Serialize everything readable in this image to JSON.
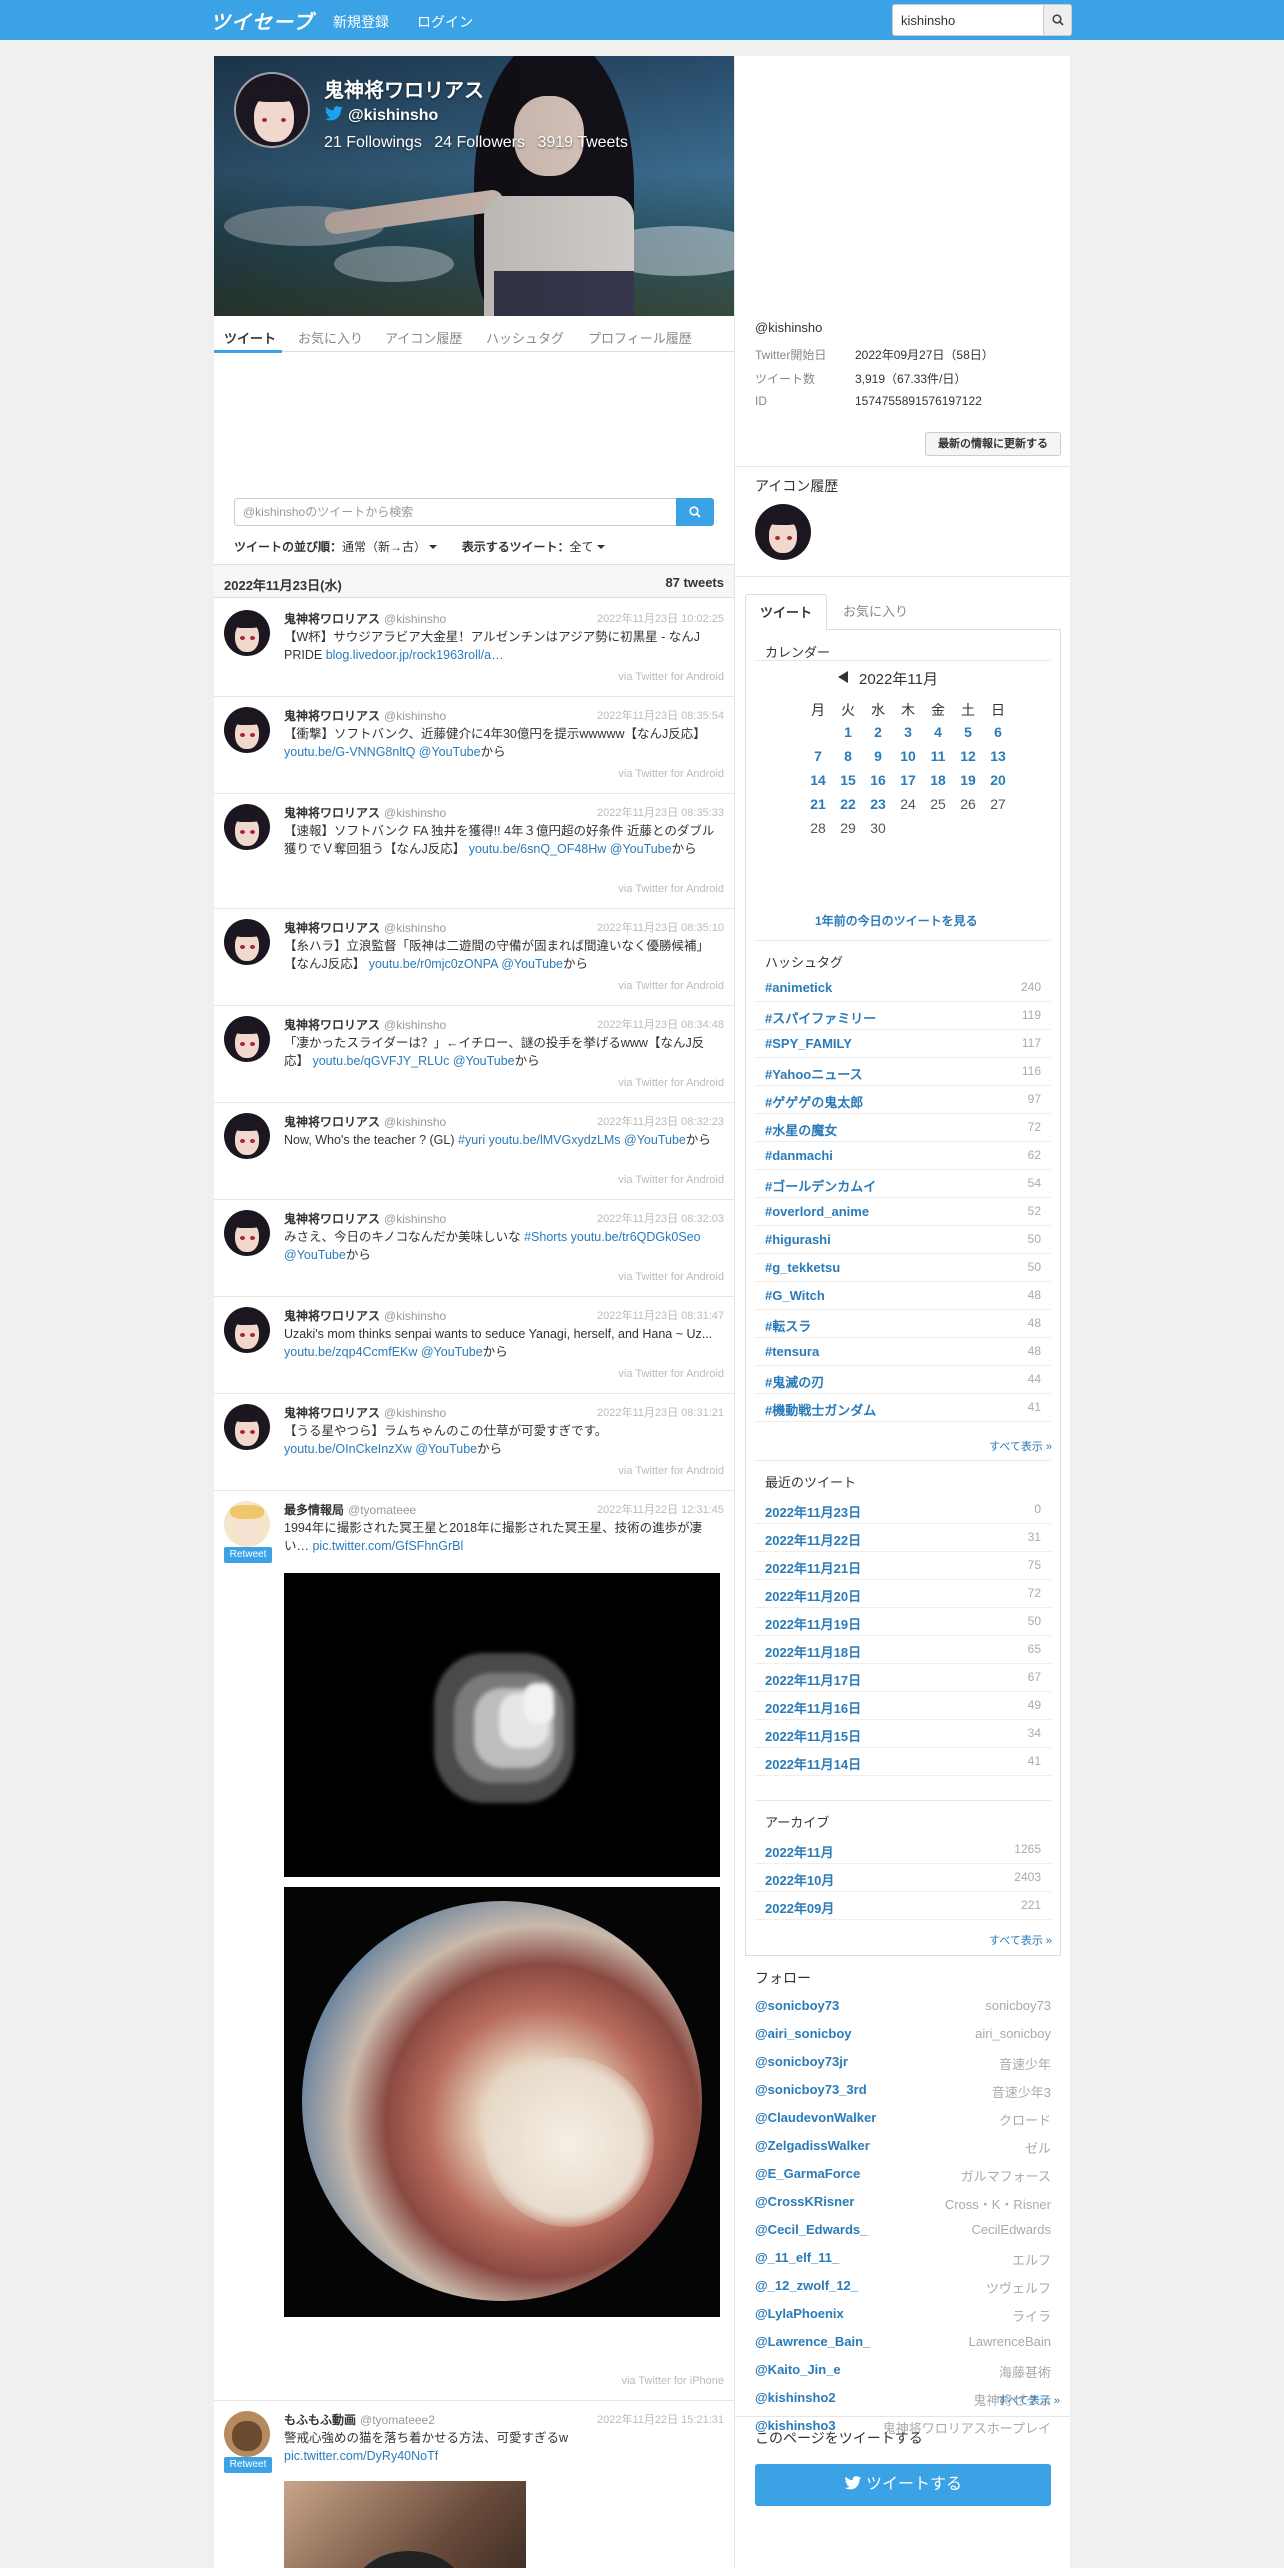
{
  "header": {
    "logo": "ツイセーブ",
    "nav": [
      "新規登録",
      "ログイン"
    ],
    "search_value": "kishinsho"
  },
  "profile": {
    "name": "鬼神将ワロリアス",
    "handle": "@kishinsho",
    "followings": "21 Followings",
    "followers": "24 Followers",
    "tweets": "3919 Tweets"
  },
  "tabs": [
    "ツイート",
    "お気に入り",
    "アイコン履歴",
    "ハッシュタグ",
    "プロフィール履歴"
  ],
  "tweet_search": {
    "placeholder": "@kishinshoのツイートから検索"
  },
  "sort": {
    "label": "ツイートの並び順：",
    "value": "通常（新→古）",
    "filter_label": "表示するツイート：",
    "filter_value": "全て"
  },
  "day_header": {
    "date": "2022年11月23日(水)",
    "count": "87 tweets"
  },
  "tweets": [
    {
      "name": "鬼神将ワロリアス",
      "handle": "@kishinsho",
      "time": "2022年11月23日 10:02:25",
      "text": "【W杯】サウジアラビア大金星！アルゼンチンはアジア勢に初黒星 - なんJ PRIDE ",
      "link": "blog.livedoor.jp/rock1963roll/a…",
      "suffix": "",
      "via": "via Twitter for Android"
    },
    {
      "name": "鬼神将ワロリアス",
      "handle": "@kishinsho",
      "time": "2022年11月23日 08:35:54",
      "text": "【衝撃】ソフトバンク、近藤健介に4年30億円を提示wwwww【なんJ反応】 ",
      "link": "youtu.be/G-VNNG8nltQ @YouTube",
      "suffix": "から",
      "via": "via Twitter for Android"
    },
    {
      "name": "鬼神将ワロリアス",
      "handle": "@kishinsho",
      "time": "2022年11月23日 08:35:33",
      "text": "【速報】ソフトバンク FA 独井を獲得!! 4年３億円超の好条件 近藤とのダブル獲りでＶ奪回狙う【なんJ反応】 ",
      "link": "youtu.be/6snQ_OF48Hw @YouTube",
      "suffix": "から",
      "via": "via Twitter for Android"
    },
    {
      "name": "鬼神将ワロリアス",
      "handle": "@kishinsho",
      "time": "2022年11月23日 08:35:10",
      "text": "【糸ハラ】立浪監督「阪神は二遊間の守備が固まれば間違いなく優勝候補」【なんJ反応】 ",
      "link": "youtu.be/r0mjc0zONPA @YouTube",
      "suffix": "から",
      "via": "via Twitter for Android"
    },
    {
      "name": "鬼神将ワロリアス",
      "handle": "@kishinsho",
      "time": "2022年11月23日 08:34:48",
      "text": "「凄かったスライダーは？」←イチロー、謎の投手を挙げるwww【なんJ反応】 ",
      "link": "youtu.be/qGVFJY_RLUc @YouTube",
      "suffix": "から",
      "via": "via Twitter for Android"
    },
    {
      "name": "鬼神将ワロリアス",
      "handle": "@kishinsho",
      "time": "2022年11月23日 08:32:23",
      "text": "Now, Who's the teacher ? (GL) ",
      "link": "#yuri youtu.be/lMVGxydzLMs @YouTube",
      "suffix": "から",
      "via": "via Twitter for Android"
    },
    {
      "name": "鬼神将ワロリアス",
      "handle": "@kishinsho",
      "time": "2022年11月23日 08:32:03",
      "text": "みさえ、今日のキノコなんだか美味しいな ",
      "link": "#Shorts youtu.be/tr6QDGk0Seo @YouTube",
      "suffix": "から",
      "via": "via Twitter for Android"
    },
    {
      "name": "鬼神将ワロリアス",
      "handle": "@kishinsho",
      "time": "2022年11月23日 08:31:47",
      "text": "Uzaki's mom thinks senpai wants to seduce Yanagi, herself, and Hana ~ Uz... ",
      "link": "youtu.be/zqp4CcmfEKw @YouTube",
      "suffix": "から",
      "via": "via Twitter for Android"
    },
    {
      "name": "鬼神将ワロリアス",
      "handle": "@kishinsho",
      "time": "2022年11月23日 08:31:21",
      "text": "【うる星やつら】ラムちゃんのこの仕草が可愛すぎです。 ",
      "link": "youtu.be/OInCkeInzXw @YouTube",
      "suffix": "から",
      "via": "via Twitter for Android"
    },
    {
      "name": "最多情報局",
      "handle": "@tyomateee",
      "time": "2022年11月22日 12:31:45",
      "text": "1994年に撮影された冥王星と2018年に撮影された冥王星、技術の進歩が凄い… ",
      "link": "pic.twitter.com/GfSFhnGrBl",
      "suffix": "",
      "via": "via Twitter for iPhone",
      "retweet": "Retweet"
    },
    {
      "name": "もふもふ動画",
      "handle": "@tyomateee2",
      "time": "2022年11月22日 15:21:31",
      "text": "警戒心強めの猫を落ち着かせる方法、可愛すぎるw ",
      "link": "pic.twitter.com/DyRy40NoTf",
      "suffix": "",
      "via": "",
      "retweet": "Retweet"
    }
  ],
  "side": {
    "handle": "@kishinsho",
    "info": [
      {
        "k": "Twitter開始日",
        "v": "2022年09月27日（58日）"
      },
      {
        "k": "ツイート数",
        "v": "3,919（67.33件/日）"
      },
      {
        "k": "ID",
        "v": "1574755891576197122"
      }
    ],
    "update_btn": "最新の情報に更新する",
    "icon_history_title": "アイコン履歴",
    "tabs": [
      "ツイート",
      "お気に入り"
    ],
    "calendar_title": "カレンダー",
    "calendar_month": "2022年11月",
    "dow": [
      "月",
      "火",
      "水",
      "木",
      "金",
      "土",
      "日"
    ],
    "see_year": "1年前の今日のツイートを見る",
    "hashtag_title": "ハッシュタグ",
    "hashtags": [
      {
        "t": "#animetick",
        "n": "240"
      },
      {
        "t": "#スパイファミリー",
        "n": "119"
      },
      {
        "t": "#SPY_FAMILY",
        "n": "117"
      },
      {
        "t": "#Yahooニュース",
        "n": "116"
      },
      {
        "t": "#ゲゲゲの鬼太郎",
        "n": "97"
      },
      {
        "t": "#水星の魔女",
        "n": "72"
      },
      {
        "t": "#danmachi",
        "n": "62"
      },
      {
        "t": "#ゴールデンカムイ",
        "n": "54"
      },
      {
        "t": "#overlord_anime",
        "n": "52"
      },
      {
        "t": "#higurashi",
        "n": "50"
      },
      {
        "t": "#g_tekketsu",
        "n": "50"
      },
      {
        "t": "#G_Witch",
        "n": "48"
      },
      {
        "t": "#転スラ",
        "n": "48"
      },
      {
        "t": "#tensura",
        "n": "48"
      },
      {
        "t": "#鬼滅の刃",
        "n": "44"
      },
      {
        "t": "#機動戦士ガンダム",
        "n": "41"
      }
    ],
    "see_all": "すべて表示 »",
    "recent_title": "最近のツイート",
    "recent": [
      {
        "t": "2022年11月23日",
        "n": "0"
      },
      {
        "t": "2022年11月22日",
        "n": "31"
      },
      {
        "t": "2022年11月21日",
        "n": "75"
      },
      {
        "t": "2022年11月20日",
        "n": "72"
      },
      {
        "t": "2022年11月19日",
        "n": "50"
      },
      {
        "t": "2022年11月18日",
        "n": "65"
      },
      {
        "t": "2022年11月17日",
        "n": "67"
      },
      {
        "t": "2022年11月16日",
        "n": "49"
      },
      {
        "t": "2022年11月15日",
        "n": "34"
      },
      {
        "t": "2022年11月14日",
        "n": "41"
      }
    ],
    "archive_title": "アーカイブ",
    "archive": [
      {
        "t": "2022年11月",
        "n": "1265"
      },
      {
        "t": "2022年10月",
        "n": "2403"
      },
      {
        "t": "2022年09月",
        "n": "221"
      }
    ],
    "follow_title": "フォロー",
    "follows": [
      {
        "h": "@sonicboy73",
        "n": "sonicboy73"
      },
      {
        "h": "@airi_sonicboy",
        "n": "airi_sonicboy"
      },
      {
        "h": "@sonicboy73jr",
        "n": "音速少年"
      },
      {
        "h": "@sonicboy73_3rd",
        "n": "音速少年3"
      },
      {
        "h": "@ClaudevonWalker",
        "n": "クロード"
      },
      {
        "h": "@ZelgadissWalker",
        "n": "ゼル"
      },
      {
        "h": "@E_GarmaForce",
        "n": "ガルマフォース"
      },
      {
        "h": "@CrossKRisner",
        "n": "Cross・K・Risner"
      },
      {
        "h": "@Cecil_Edwards_",
        "n": "CecilEdwards"
      },
      {
        "h": "@_11_elf_11_",
        "n": "エルフ"
      },
      {
        "h": "@_12_zwolf_12_",
        "n": "ツヴェルフ"
      },
      {
        "h": "@LylaPhoenix",
        "n": "ライラ"
      },
      {
        "h": "@Lawrence_Bain_",
        "n": "LawrenceBain"
      },
      {
        "h": "@Kaito_Jin_e",
        "n": "海藤甚術"
      },
      {
        "h": "@kishinsho2",
        "n": "鬼神将ゼクス"
      },
      {
        "h": "@kishinsho3",
        "n": "鬼神将ワロリアスホープレイ"
      }
    ],
    "share_title": "このページをツイートする",
    "share_btn": "ツイートする"
  },
  "colors": {
    "accent": "#3ba3e5",
    "link": "#2b7bb9"
  }
}
